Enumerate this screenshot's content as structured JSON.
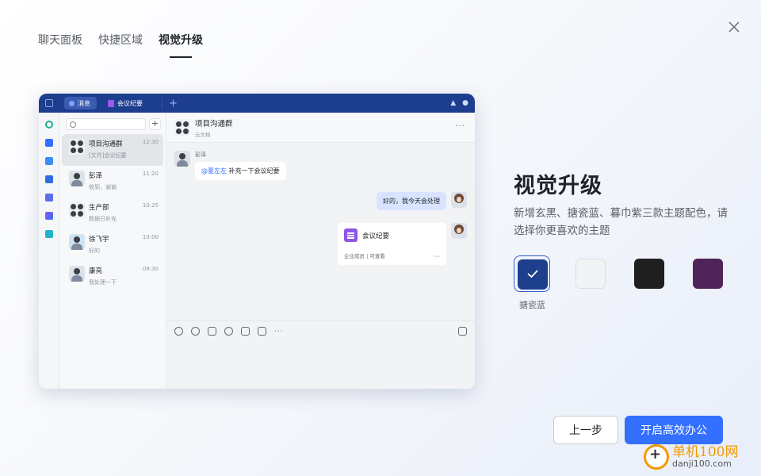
{
  "tabs": [
    {
      "label": "聊天面板"
    },
    {
      "label": "快捷区域"
    },
    {
      "label": "视觉升级"
    }
  ],
  "preview": {
    "top_tabs": [
      "消息",
      "会议纪要"
    ],
    "chats": [
      {
        "name": "项目沟通群",
        "time": "12:30",
        "sub": "[文件]会议纪要"
      },
      {
        "name": "彭泽",
        "time": "11:20",
        "sub": "收到，谢谢"
      },
      {
        "name": "生产部",
        "time": "10:25",
        "sub": "数据已补充"
      },
      {
        "name": "徐飞宇",
        "time": "10:00",
        "sub": "好的"
      },
      {
        "name": "康亮",
        "time": "09:30",
        "sub": "我处理一下"
      }
    ],
    "chat_title": "项目沟通群",
    "chat_subtitle": "云文档",
    "sender": "彭泽",
    "mention": "@夏左左",
    "message1": "补充一下会议纪要",
    "message2": "好的，我今天会处理",
    "card_title": "会议纪要",
    "card_footer": "企业成员 | 可查看"
  },
  "panel": {
    "title": "视觉升级",
    "description": "新增玄黑、搪瓷蓝、暮巾紫三款主题配色，请选择你更喜欢的主题",
    "swatches": [
      {
        "name": "搪瓷蓝",
        "color": "#1e3f8c",
        "selected": true
      },
      {
        "name": "light",
        "color": "#f2f3f5",
        "selected": false
      },
      {
        "name": "玄黑",
        "color": "#1f1f1f",
        "selected": false
      },
      {
        "name": "暮巾紫",
        "color": "#4e2459",
        "selected": false
      }
    ],
    "selected_label": "搪瓷蓝"
  },
  "buttons": {
    "prev": "上一步",
    "start": "开启高效办公"
  },
  "watermark": {
    "title": "单机100网",
    "url": "danji100.com"
  },
  "colors": {
    "accent": "#3370ff",
    "theme_blue": "#1d3d8f"
  }
}
